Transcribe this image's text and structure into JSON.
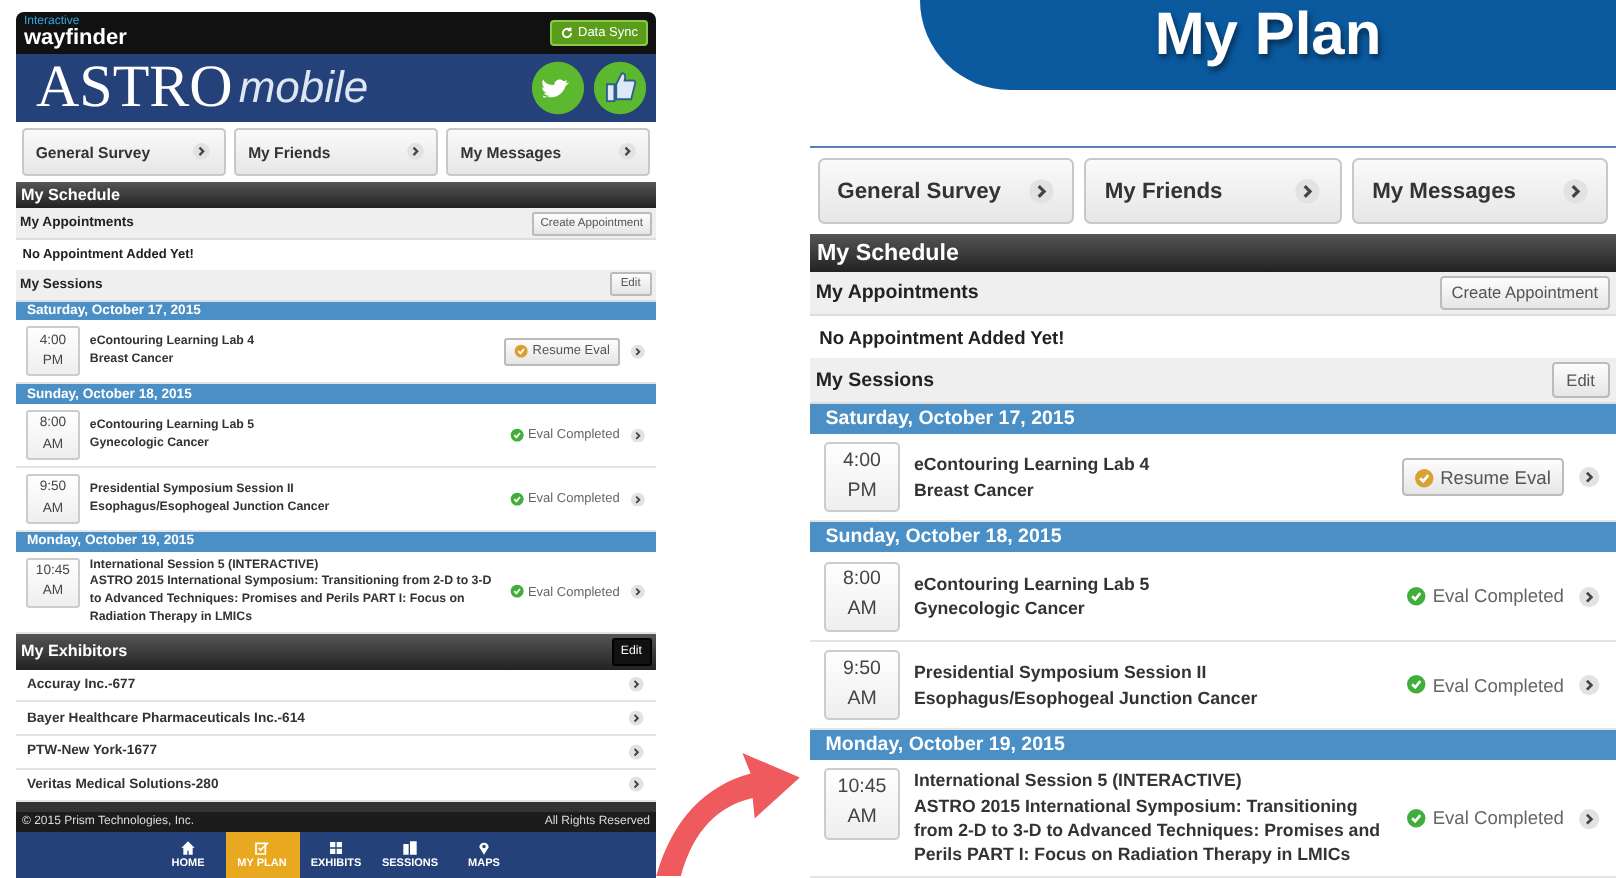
{
  "phone": {
    "brand_small": "Interactive",
    "brand": "wayfinder",
    "sync_button": "Data Sync",
    "app_title": "ASTRO",
    "app_subtitle": "mobile",
    "quick_links": [
      "General Survey",
      "My Friends",
      "My Messages"
    ],
    "schedule": {
      "title": "My Schedule",
      "appointments_title": "My Appointments",
      "appointments_button": "Create Appointment",
      "appointments_empty": "No Appointment Added Yet!",
      "sessions_title": "My Sessions",
      "sessions_edit": "Edit",
      "days": [
        {
          "date": "Saturday, October 17, 2015",
          "sessions": [
            {
              "time": "4:00",
              "meridiem": "PM",
              "title": "eContouring Learning Lab 4",
              "subtitle": "Breast Cancer",
              "eval": {
                "kind": "resume",
                "label": "Resume Eval"
              }
            }
          ]
        },
        {
          "date": "Sunday, October 18, 2015",
          "sessions": [
            {
              "time": "8:00",
              "meridiem": "AM",
              "title": "eContouring Learning Lab 5",
              "subtitle": "Gynecologic Cancer",
              "eval": {
                "kind": "completed",
                "label": "Eval Completed"
              }
            },
            {
              "time": "9:50",
              "meridiem": "AM",
              "title": "Presidential Symposium Session II",
              "subtitle": "Esophagus/Esophogeal Junction Cancer",
              "eval": {
                "kind": "completed",
                "label": "Eval Completed"
              }
            }
          ]
        },
        {
          "date": "Monday, October 19, 2015",
          "sessions": [
            {
              "time": "10:45",
              "meridiem": "AM",
              "title": "International Session 5 (INTERACTIVE)",
              "subtitle": "ASTRO 2015 International Symposium: Transitioning from 2-D to 3-D to Advanced Techniques: Promises and Perils PART I: Focus on Radiation Therapy in LMICs",
              "eval": {
                "kind": "completed",
                "label": "Eval Completed"
              }
            }
          ]
        }
      ]
    },
    "exhibitors": {
      "title": "My Exhibitors",
      "edit": "Edit",
      "items": [
        "Accuray Inc.-677",
        "Bayer Healthcare Pharmaceuticals Inc.-614",
        "PTW-New York-1677",
        "Veritas Medical Solutions-280"
      ]
    },
    "footer": {
      "copyright": "© 2015 Prism Technologies, Inc.",
      "rights": "All Rights Reserved"
    },
    "tabs": [
      {
        "kind": "home",
        "label": "HOME",
        "selected": false
      },
      {
        "kind": "plan",
        "label": "MY PLAN",
        "selected": true
      },
      {
        "kind": "exhibits",
        "label": "EXHIBITS",
        "selected": false
      },
      {
        "kind": "sessions",
        "label": "SESSIONS",
        "selected": false
      },
      {
        "kind": "maps",
        "label": "MAPS",
        "selected": false
      }
    ]
  },
  "detail": {
    "title": "My Plan",
    "quick_links": [
      "General Survey",
      "My Friends",
      "My Messages"
    ],
    "schedule": {
      "title": "My Schedule",
      "appointments_title": "My Appointments",
      "appointments_button": "Create Appointment",
      "appointments_empty": "No Appointment Added Yet!",
      "sessions_title": "My Sessions",
      "sessions_edit": "Edit",
      "days": [
        {
          "date": "Saturday, October 17, 2015",
          "sessions": [
            {
              "time": "4:00",
              "meridiem": "PM",
              "title": "eContouring Learning Lab 4",
              "subtitle": "Breast Cancer",
              "eval": {
                "kind": "resume",
                "label": "Resume Eval"
              }
            }
          ]
        },
        {
          "date": "Sunday, October 18, 2015",
          "sessions": [
            {
              "time": "8:00",
              "meridiem": "AM",
              "title": "eContouring Learning Lab 5",
              "subtitle": "Gynecologic Cancer",
              "eval": {
                "kind": "completed",
                "label": "Eval Completed"
              }
            },
            {
              "time": "9:50",
              "meridiem": "AM",
              "title": "Presidential Symposium Session II",
              "subtitle": "Esophagus/Esophogeal Junction Cancer",
              "eval": {
                "kind": "completed",
                "label": "Eval Completed"
              }
            }
          ]
        },
        {
          "date": "Monday, October 19, 2015",
          "sessions": [
            {
              "time": "10:45",
              "meridiem": "AM",
              "title": "International Session 5 (INTERACTIVE)",
              "subtitle": "ASTRO 2015 International Symposium: Transitioning from 2-D to 3-D to Advanced Techniques: Promises and Perils PART I: Focus on Radiation Therapy in LMICs",
              "eval": {
                "kind": "completed",
                "label": "Eval Completed"
              }
            }
          ]
        }
      ]
    }
  }
}
